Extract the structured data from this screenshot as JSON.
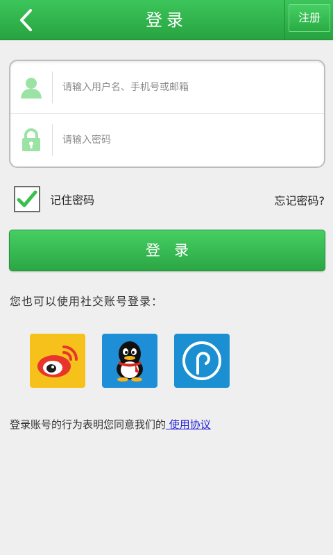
{
  "header": {
    "title": "登录",
    "register_label": "注册"
  },
  "form": {
    "username_placeholder": "请输入用户名、手机号或邮箱",
    "password_placeholder": "请输入密码"
  },
  "options": {
    "remember_label": "记住密码",
    "remember_checked": true,
    "forgot_label": "忘记密码?"
  },
  "login_button_label": "登录",
  "social": {
    "label": "您也可以使用社交账号登录：",
    "providers": [
      "weibo-icon",
      "qq-icon",
      "social-p-icon"
    ]
  },
  "agreement": {
    "text": "登录账号的行为表明您同意我们的",
    "link": " 使用协议"
  },
  "colors": {
    "brand_green": "#2ba644",
    "link_blue": "#1b1bd8",
    "weibo_bg": "#f6c11a",
    "qq_bg": "#1e8fd6"
  }
}
